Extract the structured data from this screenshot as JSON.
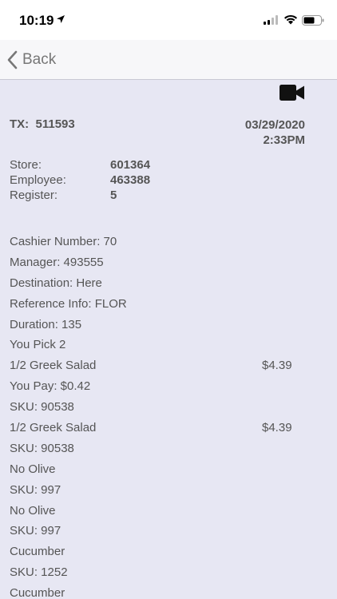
{
  "status": {
    "time": "10:19"
  },
  "nav": {
    "back_label": "Back"
  },
  "icons": {
    "camera": "video-camera-icon",
    "back": "chevron-left-icon"
  },
  "transaction": {
    "tx_label": "TX:",
    "tx_number": "511593",
    "date": "03/29/2020",
    "time": "2:33PM",
    "store_label": "Store:",
    "store_value": "601364",
    "employee_label": "Employee:",
    "employee_value": "463388",
    "register_label": "Register:",
    "register_value": "5"
  },
  "lines": [
    {
      "text": "Cashier Number: 70",
      "price": ""
    },
    {
      "text": "Manager: 493555",
      "price": ""
    },
    {
      "text": "Destination: Here",
      "price": ""
    },
    {
      "text": "Reference Info: FLOR",
      "price": ""
    },
    {
      "text": "Duration: 135",
      "price": ""
    },
    {
      "text": "You Pick 2",
      "price": ""
    },
    {
      "text": "1/2 Greek Salad",
      "price": "$4.39"
    },
    {
      "text": "You Pay: $0.42",
      "price": ""
    },
    {
      "text": "SKU: 90538",
      "price": ""
    },
    {
      "text": "1/2 Greek Salad",
      "price": "$4.39"
    },
    {
      "text": "SKU: 90538",
      "price": ""
    },
    {
      "text": "No Olive",
      "price": ""
    },
    {
      "text": "SKU: 997",
      "price": ""
    },
    {
      "text": "No Olive",
      "price": ""
    },
    {
      "text": "SKU: 997",
      "price": ""
    },
    {
      "text": "Cucumber",
      "price": ""
    },
    {
      "text": "SKU: 1252",
      "price": ""
    },
    {
      "text": "Cucumber",
      "price": ""
    }
  ]
}
